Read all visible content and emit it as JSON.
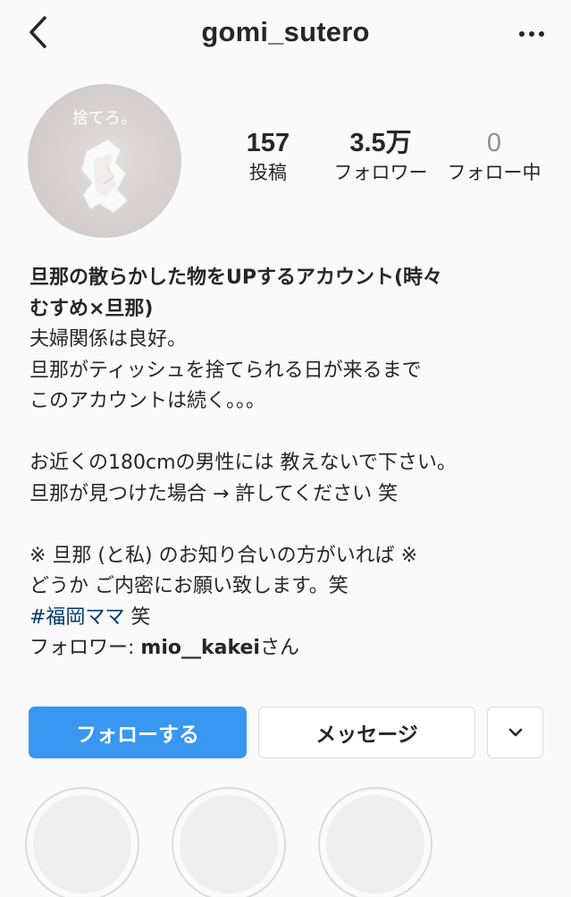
{
  "header": {
    "username": "gomi_sutero"
  },
  "avatar": {
    "text": "捨てろ。",
    "background": "#d9d4d2"
  },
  "stats": {
    "posts": {
      "value": "157",
      "label": "投稿"
    },
    "followers": {
      "value": "3.5万",
      "label": "フォロワー"
    },
    "following": {
      "value": "0",
      "label": "フォロー中"
    }
  },
  "bio": {
    "name": "旦那の散らかした物をUPするアカウント(時々むすめ×旦那)",
    "name_line1": "旦那の散らかした物をUPするアカウント(時々",
    "name_line2": "むすめ×旦那)",
    "lines": [
      "夫婦関係は良好。",
      "旦那がティッシュを捨てられる日が来るまで",
      "このアカウントは続く。。。",
      "",
      "お近くの180cmの男性には 教えないで下さい。",
      "旦那が見つけた場合 → 許してください 笑",
      "",
      "※ 旦那 (と私) のお知り合いの方がいれば ※",
      "どうか ご内密にお願い致します。笑"
    ],
    "hashtag": "#福岡ママ",
    "hashtag_suffix": " 笑",
    "followed_by_prefix": "フォロワー: ",
    "followed_by_user": "mio__kakei",
    "followed_by_suffix": "さん"
  },
  "actions": {
    "follow_label": "フォローする",
    "message_label": "メッセージ"
  },
  "colors": {
    "follow_button": "#3897f0",
    "hashtag": "#00376b",
    "border": "#dbdbdb",
    "muted": "#8e8e8e"
  },
  "icons": {
    "back": "chevron-left-icon",
    "more": "more-horizontal-icon",
    "dropdown": "chevron-down-icon"
  }
}
